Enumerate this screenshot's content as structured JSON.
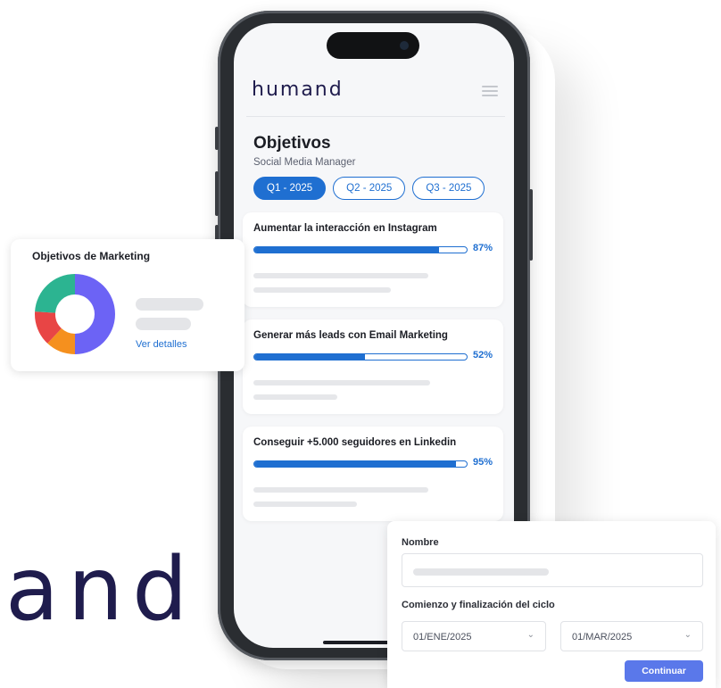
{
  "brand_fragment": "and",
  "app": {
    "logo": "humand",
    "title": "Objetivos",
    "subtitle": "Social Media Manager",
    "tabs": [
      {
        "label": "Q1 - 2025",
        "active": true
      },
      {
        "label": "Q2 - 2025",
        "active": false
      },
      {
        "label": "Q3 - 2025",
        "active": false
      }
    ],
    "objectives": [
      {
        "title": "Aumentar la interacción en Instagram",
        "progress": 87,
        "progress_label": "87%"
      },
      {
        "title": "Generar más leads con Email Marketing",
        "progress": 52,
        "progress_label": "52%"
      },
      {
        "title": "Conseguir +5.000 seguidores en Linkedin",
        "progress": 95,
        "progress_label": "95%"
      }
    ]
  },
  "marketing_card": {
    "title": "Objetivos de Marketing",
    "link": "Ver detalles",
    "donut_segments": [
      {
        "value": 50,
        "color": "#6c63f5"
      },
      {
        "value": 12,
        "color": "#f5901e"
      },
      {
        "value": 14,
        "color": "#e84545"
      },
      {
        "value": 24,
        "color": "#2cb491"
      }
    ]
  },
  "form": {
    "name_label": "Nombre",
    "cycle_label": "Comienzo y finalización del ciclo",
    "start_date": "01/ENE/2025",
    "end_date": "01/MAR/2025",
    "submit_label": "Continuar"
  },
  "colors": {
    "accent": "#1f6fd1",
    "brand": "#1f1c4d",
    "button": "#5a78ea"
  }
}
